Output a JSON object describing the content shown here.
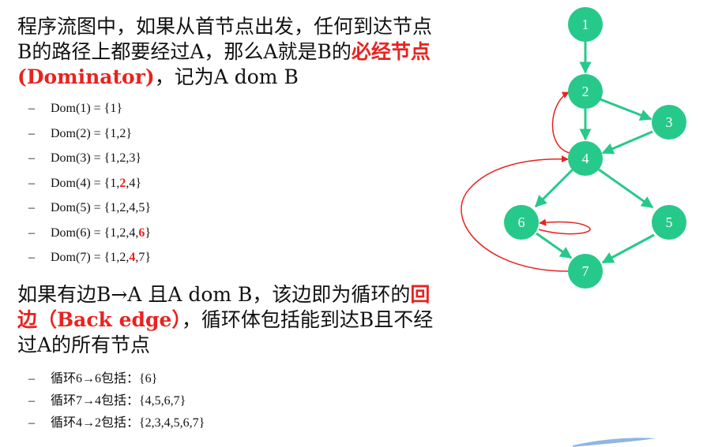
{
  "para1": {
    "text1": "程序流图中，如果从首节点出发，任何到达节点B的路径上都要经过A，那么A就是B的",
    "highlight": "必经节点(Dominator)",
    "text2": "，记为A dom B"
  },
  "dominators": [
    {
      "prefix": "Dom(1) = {1}",
      "red": "",
      "suffix": ""
    },
    {
      "prefix": "Dom(2) = {1,2}",
      "red": "",
      "suffix": ""
    },
    {
      "prefix": "Dom(3) = {1,2,3}",
      "red": "",
      "suffix": ""
    },
    {
      "prefix": "Dom(4) = {1,",
      "red": "2",
      "suffix": ",4}"
    },
    {
      "prefix": "Dom(5) = {1,2,4,5}",
      "red": "",
      "suffix": ""
    },
    {
      "prefix": "Dom(6) = {1,2,4,",
      "red": "6",
      "suffix": "}"
    },
    {
      "prefix": "Dom(7) = {1,2,",
      "red": "4",
      "suffix": ",7}"
    }
  ],
  "para2": {
    "text1": "如果有边B→A 且A dom B，该边即为循环的",
    "highlight": "回边（Back edge）",
    "text2": "，循环体包括能到达B且不经过A的所有节点"
  },
  "loops": [
    "循环6→6包括：{6}",
    "循环7→4包括：{4,5,6,7}",
    "循环4→2包括：{2,3,4,5,6,7}"
  ],
  "graph": {
    "node_color": "#27c98a",
    "edge_color": "#27c98a",
    "back_edge_color": "#e8231f",
    "nodes": [
      "1",
      "2",
      "3",
      "4",
      "5",
      "6",
      "7"
    ]
  }
}
